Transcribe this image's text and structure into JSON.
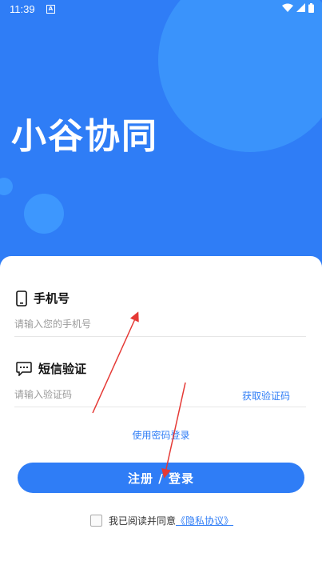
{
  "status_bar": {
    "time": "11:39",
    "indicator": "A"
  },
  "app": {
    "title": "小谷协同"
  },
  "phone": {
    "label": "手机号",
    "placeholder": "请输入您的手机号"
  },
  "sms": {
    "label": "短信验证",
    "placeholder": "请输入验证码",
    "get_code": "获取验证码"
  },
  "password_login_link": "使用密码登录",
  "login_button": "注册 / 登录",
  "agreement": {
    "text": "我已阅读并同意",
    "link": "《隐私协议》",
    "checked": false
  },
  "colors": {
    "primary": "#2f7df6",
    "annotation": "#e53935"
  }
}
